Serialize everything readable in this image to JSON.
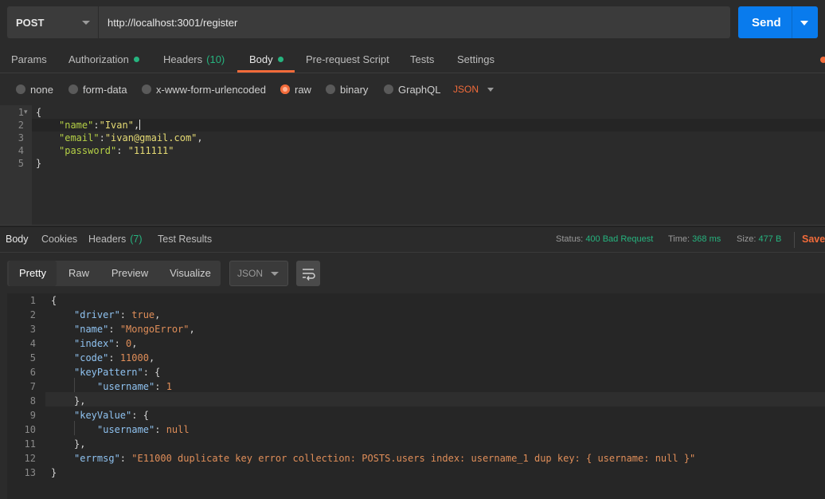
{
  "request": {
    "method": "POST",
    "url": "http://localhost:3001/register",
    "send_label": "Send"
  },
  "request_tabs": [
    {
      "label": "Params"
    },
    {
      "label": "Authorization"
    },
    {
      "label": "Headers",
      "count": "(10)"
    },
    {
      "label": "Body"
    },
    {
      "label": "Pre-request Script"
    },
    {
      "label": "Tests"
    },
    {
      "label": "Settings"
    }
  ],
  "body_types": [
    {
      "label": "none"
    },
    {
      "label": "form-data"
    },
    {
      "label": "x-www-form-urlencoded"
    },
    {
      "label": "raw",
      "selected": true
    },
    {
      "label": "binary"
    },
    {
      "label": "GraphQL"
    }
  ],
  "body_format": "JSON",
  "request_body": {
    "line_numbers": [
      "1",
      "2",
      "3",
      "4",
      "5"
    ],
    "open": "{",
    "close": "}",
    "fields": [
      {
        "key": "\"name\"",
        "sep": ":",
        "value": "\"Ivan\"",
        "trail": ","
      },
      {
        "key": "\"email\"",
        "sep": ":",
        "value": "\"ivan@gmail.com\"",
        "trail": ","
      },
      {
        "key": "\"password\"",
        "sep": ": ",
        "value": "\"111111\"",
        "trail": ""
      }
    ]
  },
  "response_tabs": [
    {
      "label": "Body"
    },
    {
      "label": "Cookies"
    },
    {
      "label": "Headers",
      "count": "(7)"
    },
    {
      "label": "Test Results"
    }
  ],
  "response_meta": {
    "status_label": "Status:",
    "status_value": "400 Bad Request",
    "time_label": "Time:",
    "time_value": "368 ms",
    "size_label": "Size:",
    "size_value": "477 B",
    "save_label": "Save"
  },
  "view_modes": [
    {
      "label": "Pretty",
      "active": true
    },
    {
      "label": "Raw"
    },
    {
      "label": "Preview"
    },
    {
      "label": "Visualize"
    }
  ],
  "response_format": "JSON",
  "response_body": {
    "line_numbers": [
      "1",
      "2",
      "3",
      "4",
      "5",
      "6",
      "7",
      "8",
      "9",
      "10",
      "11",
      "12",
      "13"
    ],
    "lines": [
      {
        "k": "",
        "p": "{",
        "v": ""
      },
      {
        "k": "\"driver\"",
        "p": ": ",
        "v": "true",
        "t": ","
      },
      {
        "k": "\"name\"",
        "p": ": ",
        "v": "\"MongoError\"",
        "t": ","
      },
      {
        "k": "\"index\"",
        "p": ": ",
        "v": "0",
        "t": ","
      },
      {
        "k": "\"code\"",
        "p": ": ",
        "v": "11000",
        "t": ","
      },
      {
        "k": "\"keyPattern\"",
        "p": ": {",
        "v": "",
        "t": ""
      },
      {
        "k": "\"username\"",
        "p": ": ",
        "v": "1",
        "t": ""
      },
      {
        "k": "",
        "p": "},",
        "v": ""
      },
      {
        "k": "\"keyValue\"",
        "p": ": {",
        "v": "",
        "t": ""
      },
      {
        "k": "\"username\"",
        "p": ": ",
        "v": "null",
        "t": ""
      },
      {
        "k": "",
        "p": "},",
        "v": ""
      },
      {
        "k": "\"errmsg\"",
        "p": ": ",
        "v": "\"E11000 duplicate key error collection: POSTS.users index: username_1 dup key: { username: null }\"",
        "t": ""
      },
      {
        "k": "",
        "p": "}",
        "v": ""
      }
    ]
  },
  "colors": {
    "accent": "#f26b3a",
    "send": "#097bed",
    "success": "#26b47f"
  }
}
